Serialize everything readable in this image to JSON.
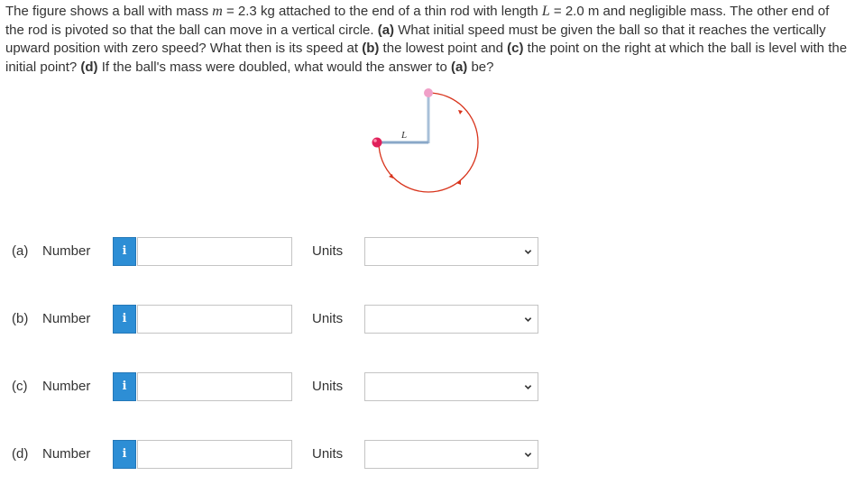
{
  "problem": {
    "p1": "The figure shows a ball with mass ",
    "m_sym": "m",
    "p2": " = 2.3 kg attached to the end of a thin rod with length ",
    "L_sym": "L",
    "p3": " = 2.0 m and negligible mass. The other end of the rod is pivoted so that the ball can move in a vertical circle. ",
    "a_tag": "(a)",
    "p4": " What initial speed must be given the ball so that it reaches the vertically upward position with zero speed? What then is its speed at ",
    "b_tag": "(b)",
    "p5": " the lowest point and ",
    "c_tag": "(c)",
    "p6": " the point on the right at which the ball is level with the initial point? ",
    "d_tag": "(d)",
    "p7": " If the ball's mass were doubled, what would the answer to ",
    "a_tag2": "(a)",
    "p8": " be?"
  },
  "figure": {
    "rod_label": "L",
    "colors": {
      "circle": "#d8341c",
      "ball": "#e0205a",
      "ghost_ball": "#f0a0c8",
      "rod": "#8aa8c8"
    }
  },
  "rows": [
    {
      "part": "(a)",
      "number_label": "Number",
      "info_icon": "i",
      "value": "",
      "units_label": "Units",
      "units_value": ""
    },
    {
      "part": "(b)",
      "number_label": "Number",
      "info_icon": "i",
      "value": "",
      "units_label": "Units",
      "units_value": ""
    },
    {
      "part": "(c)",
      "number_label": "Number",
      "info_icon": "i",
      "value": "",
      "units_label": "Units",
      "units_value": ""
    },
    {
      "part": "(d)",
      "number_label": "Number",
      "info_icon": "i",
      "value": "",
      "units_label": "Units",
      "units_value": ""
    }
  ]
}
